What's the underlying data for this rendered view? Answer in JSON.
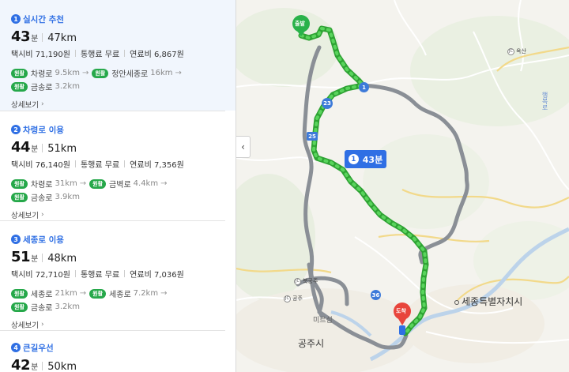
{
  "routes": [
    {
      "num": "1",
      "name": "실시간 추천",
      "time_value": "43",
      "time_unit": "분",
      "distance": "47km",
      "taxi": "택시비 71,190원",
      "toll": "통행료 무료",
      "fuel": "연료비 6,867원",
      "roads": [
        [
          {
            "tag": "원활",
            "name": "차령로",
            "km": "9.5km"
          },
          {
            "tag": "원활",
            "name": "정안세종로",
            "km": "16km"
          }
        ],
        [
          {
            "tag": "원활",
            "name": "금송로",
            "km": "3.2km"
          }
        ]
      ],
      "detail": "상세보기"
    },
    {
      "num": "2",
      "name": "차령로 이용",
      "time_value": "44",
      "time_unit": "분",
      "distance": "51km",
      "taxi": "택시비 76,140원",
      "toll": "통행료 무료",
      "fuel": "연료비 7,356원",
      "roads": [
        [
          {
            "tag": "원활",
            "name": "차령로",
            "km": "31km"
          },
          {
            "tag": "원활",
            "name": "금벽로",
            "km": "4.4km"
          }
        ],
        [
          {
            "tag": "원활",
            "name": "금송로",
            "km": "3.9km"
          }
        ]
      ],
      "detail": "상세보기"
    },
    {
      "num": "3",
      "name": "세종로 이용",
      "time_value": "51",
      "time_unit": "분",
      "distance": "48km",
      "taxi": "택시비 72,710원",
      "toll": "통행료 무료",
      "fuel": "연료비 7,036원",
      "roads": [
        [
          {
            "tag": "원활",
            "name": "세종로",
            "km": "21km"
          },
          {
            "tag": "원활",
            "name": "세종로",
            "km": "7.2km"
          }
        ],
        [
          {
            "tag": "원활",
            "name": "금송로",
            "km": "3.2km"
          }
        ]
      ],
      "detail": "상세보기"
    },
    {
      "num": "4",
      "name": "큰길우선",
      "time_value": "42",
      "time_unit": "분",
      "distance": "50km"
    }
  ],
  "map": {
    "bubble_num": "1",
    "bubble_time": "43분",
    "start_label": "출발",
    "end_label": "도착",
    "labels": {
      "sejong": "세종특별자치시",
      "gongju": "공주시",
      "miryeong": "미르섬",
      "jc_bukgongju": "북공주",
      "jc_gongju": "공주",
      "jc_ok": "옥산",
      "right_label": "행복로"
    },
    "shields": {
      "r1": "1",
      "r23": "23",
      "r25": "25",
      "r36": "36"
    },
    "colors": {
      "route_main": "#3ec33f",
      "route_alt": "#8a8f96",
      "accent": "#2f6fe4",
      "end_pin": "#e8453c",
      "start_pin": "#29b24a"
    }
  },
  "ui": {
    "collapse_icon": "‹"
  }
}
